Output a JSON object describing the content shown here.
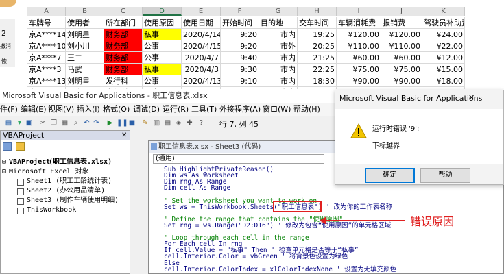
{
  "sheet": {
    "column_letters": [
      "A",
      "B",
      "C",
      "D",
      "E",
      "F",
      "G",
      "H",
      "I",
      "J",
      "K"
    ],
    "side_labels": [
      "2",
      "撤消",
      "恢"
    ],
    "headers": [
      "车牌号",
      "使用者",
      "所在部门",
      "使用原因",
      "使用日期",
      "开始时间",
      "目的地",
      "交车时间",
      "车辆消耗费",
      "报销费",
      "驾驶员补助费"
    ],
    "rows": [
      {
        "cells": [
          "京A****14",
          "刘明星",
          "财务部",
          "私事",
          "2020/4/14",
          "9:20",
          "市内",
          "19:25",
          "¥120.00",
          "¥120.00",
          "¥24.00"
        ],
        "dept": "red",
        "reason": "yellow"
      },
      {
        "cells": [
          "京A****10",
          "刘小川",
          "财务部",
          "公事",
          "2020/4/15",
          "9:20",
          "市外",
          "20:25",
          "¥110.00",
          "¥110.00",
          "¥22.00"
        ],
        "dept": "red",
        "reason": "none"
      },
      {
        "cells": [
          "京A****7",
          "王二",
          "财务部",
          "公事",
          "2020/4/7",
          "9:40",
          "市内",
          "21:25",
          "¥60.00",
          "¥60.00",
          "¥12.00"
        ],
        "dept": "red",
        "reason": "none"
      },
      {
        "cells": [
          "京A****3",
          "马武",
          "财务部",
          "私事",
          "2020/4/3",
          "9:30",
          "市内",
          "22:25",
          "¥75.00",
          "¥75.00",
          "¥15.00"
        ],
        "dept": "red",
        "reason": "yellow"
      },
      {
        "cells": [
          "京A****13",
          "刘明星",
          "发行科",
          "公事",
          "2020/4/13",
          "9:10",
          "市内",
          "18:30",
          "¥90.00",
          "¥90.00",
          "¥18.00"
        ],
        "dept": "none",
        "reason": "none"
      },
      {
        "cells": [
          "京A****9",
          "马赤",
          "发行科",
          "公事",
          "2020/4/9",
          "9:10",
          "市内",
          "16:20",
          "¥75.00",
          "¥75.00",
          "¥15.00"
        ],
        "dept": "none",
        "reason": "none"
      }
    ]
  },
  "vba": {
    "title": "Microsoft Visual Basic for Applications - 职工信息表.xlsx",
    "menus": [
      "件(F)",
      "编辑(E)",
      "视图(V)",
      "插入(I)",
      "格式(O)",
      "调试(D)",
      "运行(R)",
      "工具(T)",
      "外接程序(A)",
      "窗口(W)",
      "帮助(H)"
    ],
    "cursor_position": "行 7, 列 45",
    "project_pane_title": "VBAProject",
    "tree": {
      "root": "VBAProject",
      "root_file": "(职工信息表.xlsx)",
      "folder": "Microsoft Excel 对象",
      "items": [
        "Sheet1 (职工工龄统计表)",
        "Sheet2 (办公用品清单)",
        "Sheet3 (制作车辆使用明细)",
        "ThisWorkbook"
      ]
    },
    "code_window_title": "职工信息表.xlsx - Sheet3 (代码)",
    "object_dropdown": "(通用)",
    "code_lines": [
      {
        "text": "Sub HighlightPrivateReason()",
        "kind": "kw"
      },
      {
        "text": "    Dim ws As Worksheet",
        "kind": "kw"
      },
      {
        "text": "    Dim rng As Range",
        "kind": "kw"
      },
      {
        "text": "    Dim cell As Range",
        "kind": "kw"
      },
      {
        "text": "",
        "kind": "plain"
      },
      {
        "text": "    ' Set the worksheet you want to work on",
        "kind": "cm"
      },
      {
        "text": "    Set ws = ThisWorkbook.Sheets(\"职工信息表\")  ' 改为你的工作表名称",
        "kind": "mixed"
      },
      {
        "text": "",
        "kind": "plain"
      },
      {
        "text": "    ' Define the range that contains the \"使用原因\"",
        "kind": "cm"
      },
      {
        "text": "    Set rng = ws.Range(\"D2:D16\")  ' 修改为包含“使用原因”的单元格区域",
        "kind": "mixed2"
      },
      {
        "text": "",
        "kind": "plain"
      },
      {
        "text": "    ' Loop through each cell in the range",
        "kind": "cm"
      },
      {
        "text": "    For Each cell In rng",
        "kind": "kw"
      },
      {
        "text": "        If cell.Value = \"私事\" Then  ' 检查单元格是否等于“私事”",
        "kind": "mixed3"
      },
      {
        "text": "            cell.Interior.Color = vbGreen  ' 将背景色设置为绿色",
        "kind": "mixed4"
      },
      {
        "text": "        Else",
        "kind": "kw"
      },
      {
        "text": "            cell.Interior.ColorIndex = xlColorIndexNone  ' 设置为无填充颜色",
        "kind": "mixed5"
      }
    ],
    "annotation": "错误原因"
  },
  "dialog": {
    "title": "Microsoft Visual Basic for Applications",
    "close": "✕",
    "line1": "运行时错误 '9':",
    "line2": "下标越界",
    "ok_label": "确定",
    "help_label": "帮助",
    "icon": "warning-icon"
  },
  "colors": {
    "red": "#ff0000",
    "yellow": "#ffff00",
    "annotation": "#e02020",
    "dialog_accent": "#0078d7"
  }
}
